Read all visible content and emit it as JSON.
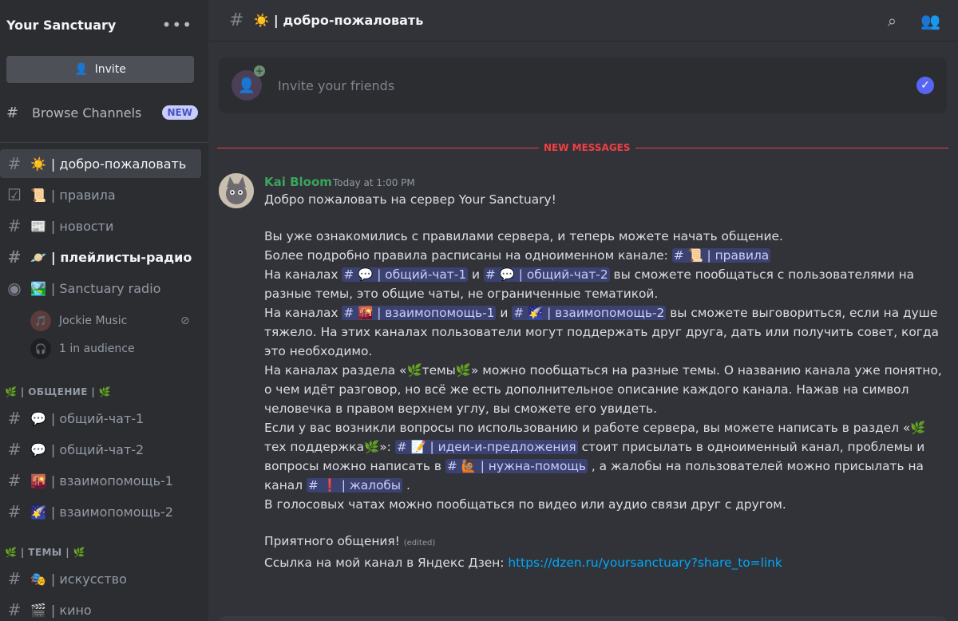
{
  "server": {
    "name": "Your Sanctuary",
    "menu_icon": "more-dots-icon"
  },
  "sidebar": {
    "invite_label": "Invite",
    "browse_label": "Browse Channels",
    "browse_badge": "NEW",
    "channels": [
      {
        "emoji": "☀️",
        "label": "| добро-пожаловать"
      },
      {
        "emoji": "📜",
        "label": "| правила"
      },
      {
        "emoji": "📰",
        "label": "| новости"
      },
      {
        "emoji": "🪐",
        "label": "| плейлисты-радио"
      },
      {
        "emoji": "🏞️",
        "label": "| Sanctuary radio"
      }
    ],
    "voice_user": "Jockie Music",
    "audience": "1 in audience",
    "category_1": "🌿 | ОБЩЕНИЕ | 🌿",
    "channels_2": [
      {
        "emoji": "💬",
        "label": "| общий-чат-1"
      },
      {
        "emoji": "💬",
        "label": "| общий-чат-2"
      },
      {
        "emoji": "🌇",
        "label": "| взаимопомощь-1"
      },
      {
        "emoji": "🌠",
        "label": "| взаимопомощь-2"
      }
    ],
    "category_2": "🌿 | ТЕМЫ | 🌿",
    "channels_3": [
      {
        "emoji": "🎭",
        "label": "| искусство"
      },
      {
        "emoji": "🎬",
        "label": "| кино"
      }
    ]
  },
  "topbar": {
    "title": "☀️ | добро-пожаловать"
  },
  "invite_card": {
    "text": "Invite your friends"
  },
  "divider": {
    "label": "NEW MESSAGES"
  },
  "message": {
    "author": "Kai Bloom",
    "time": "Today at 1:00 PM",
    "l1": "Добро пожаловать на сервер Your Sanctuary!",
    "l2": "Вы уже ознакомились с правилами сервера, и теперь можете начать общение.",
    "l3": "Более подробно правила расписаны на одноименном канале: ",
    "m_rules": "# 📜 | правила",
    "l4a": "На каналах ",
    "m_chat1": "# 💬 | общий-чат-1",
    "l4b": " и ",
    "m_chat2": "# 💬 | общий-чат-2",
    "l4c": " вы сможете пообщаться с пользователями на разные темы, это общие чаты, не ограниченные тематикой.",
    "l5a": "На каналах ",
    "m_help1": "# 🌇 | взаимопомощь-1",
    "l5b": " и ",
    "m_help2": "# 🌠 | взаимопомощь-2",
    "l5c": " вы сможете выговориться, если на душе тяжело. На этих каналах пользователи могут поддержать друг друга, дать или получить совет, когда это необходимо.",
    "l6": "На каналах раздела «🌿темы🌿» можно пообщаться на разные темы. О названию канала уже понятно, о чем идёт разговор, но всё же есть дополнительное описание каждого канала. Нажав на символ человечка в правом верхнем углу, вы сможете его увидеть.",
    "l7a": "Если у вас возникли вопросы по использованию и работе сервера, вы можете написать в раздел «🌿тех поддержка🌿»: ",
    "m_ideas": "# 📝 | идеи-и-предложения",
    "l7b": "  стоит присылать в одноименный канал, проблемы и вопросы можно написать в ",
    "m_needhelp": "# 🙋🏽 | нужна-помощь",
    "l7c": " , а жалобы на пользователей можно присылать на канал ",
    "m_complaints": "# ❗ | жалобы",
    "l7d": " .",
    "l8": "В голосовых чатах можно пообщаться по видео или аудио связи друг с другом.",
    "l9": "Приятного общения!",
    "edited": "(edited)",
    "l10": "Ссылка на мой канал в Яндекс Дзен: ",
    "link": "https://dzen.ru/yoursanctuary?share_to=link"
  }
}
